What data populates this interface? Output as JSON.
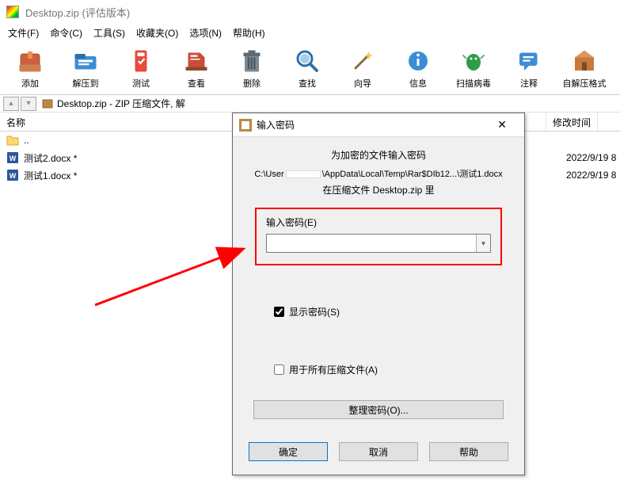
{
  "window": {
    "title": "Desktop.zip (评估版本)"
  },
  "menu": {
    "file": "文件(F)",
    "cmd": "命令(C)",
    "tools": "工具(S)",
    "fav": "收藏夹(O)",
    "opts": "选项(N)",
    "help": "帮助(H)"
  },
  "toolbar": {
    "add": "添加",
    "extract": "解压到",
    "test": "测试",
    "view": "查看",
    "delete": "删除",
    "find": "查找",
    "wizard": "向导",
    "info": "信息",
    "scan": "扫描病毒",
    "comment": "注释",
    "sfx": "自解压格式"
  },
  "address": {
    "path": "Desktop.zip - ZIP 压缩文件, 解"
  },
  "columns": {
    "name": "名称",
    "modified": "修改时间"
  },
  "rows": {
    "up": "..",
    "f1": {
      "name": "测试2.docx *",
      "time": "2022/9/19 8"
    },
    "f2": {
      "name": "测试1.docx *",
      "time": "2022/9/19 8"
    }
  },
  "dialog": {
    "title": "输入密码",
    "prompt": "为加密的文件输入密码",
    "path_prefix": "C:\\User",
    "path_suffix": "\\AppData\\Local\\Temp\\Rar$DIb12...\\测试1.docx",
    "sub": "在压缩文件 Desktop.zip 里",
    "label": "输入密码(E)",
    "showpwd": "显示密码(S)",
    "allarchives": "用于所有压缩文件(A)",
    "organize": "整理密码(O)...",
    "ok": "确定",
    "cancel": "取消",
    "help": "帮助"
  }
}
